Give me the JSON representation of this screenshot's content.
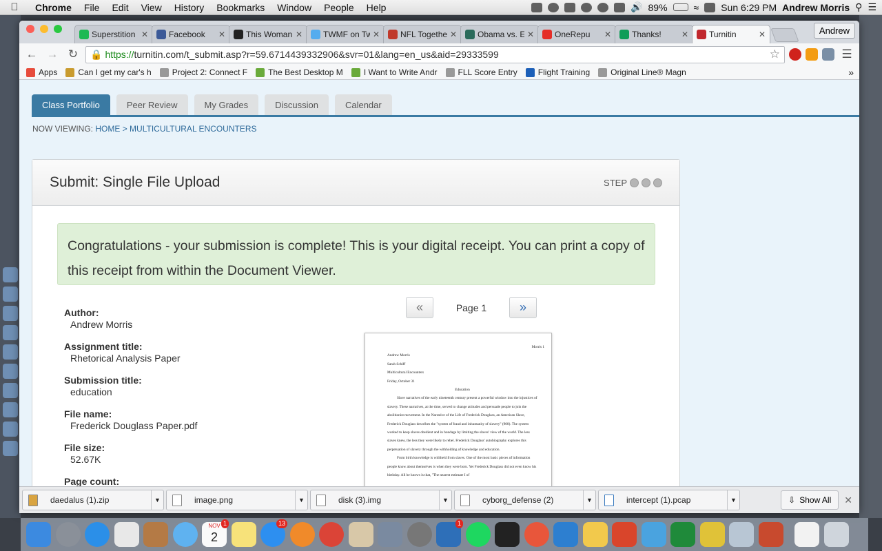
{
  "menubar": {
    "app": "Chrome",
    "items": [
      "File",
      "Edit",
      "View",
      "History",
      "Bookmarks",
      "Window",
      "People",
      "Help"
    ],
    "battery": "89%",
    "clock": "Sun 6:29 PM",
    "user": "Andrew Morris"
  },
  "browser": {
    "profile": "Andrew",
    "tabs": [
      {
        "title": "Superstition",
        "color": "#1db954"
      },
      {
        "title": "Facebook",
        "color": "#3b5998"
      },
      {
        "title": "This Woman",
        "color": "#222222"
      },
      {
        "title": "TWMF on Tw",
        "color": "#55acee"
      },
      {
        "title": "NFL Togethe",
        "color": "#c0392b"
      },
      {
        "title": "Obama vs. E",
        "color": "#2b6b5b"
      },
      {
        "title": "OneRepu",
        "color": "#e52d27"
      },
      {
        "title": "Thanks!",
        "color": "#0f9d58"
      },
      {
        "title": "Turnitin",
        "color": "#c1272d",
        "active": true
      }
    ],
    "url_scheme": "https://",
    "url_rest": "turnitin.com/t_submit.asp?r=59.6714439332906&svr=01&lang=en_us&aid=29333599",
    "bookmarks": [
      {
        "label": "Apps",
        "color": "#e74c3c"
      },
      {
        "label": "Can I get my car's h",
        "color": "#c99b2e"
      },
      {
        "label": "Project 2: Connect F",
        "color": "#999999"
      },
      {
        "label": "The Best Desktop M",
        "color": "#6aaa3a"
      },
      {
        "label": "I Want to Write Andr",
        "color": "#6aaa3a"
      },
      {
        "label": "FLL Score Entry",
        "color": "#999999"
      },
      {
        "label": "Flight Training",
        "color": "#1c5fb8"
      },
      {
        "label": "Original Line® Magn",
        "color": "#999999"
      }
    ]
  },
  "page": {
    "tabs": [
      "Class Portfolio",
      "Peer Review",
      "My Grades",
      "Discussion",
      "Calendar"
    ],
    "breadcrumb_prefix": "NOW VIEWING:",
    "breadcrumb_home": "HOME",
    "breadcrumb_sep": ">",
    "breadcrumb_current": "MULTICULTURAL ENCOUNTERS",
    "panel_title": "Submit: Single File Upload",
    "step_label": "STEP",
    "alert": "Congratulations - your submission is complete! This is your digital receipt. You can print a copy of this receipt from within the Document Viewer.",
    "fields": [
      {
        "label": "Author:",
        "value": "Andrew Morris"
      },
      {
        "label": "Assignment title:",
        "value": "Rhetorical Analysis Paper"
      },
      {
        "label": "Submission title:",
        "value": "education"
      },
      {
        "label": "File name:",
        "value": "Frederick Douglass Paper.pdf"
      },
      {
        "label": "File size:",
        "value": "52.67K"
      },
      {
        "label": "Page count:",
        "value": ""
      }
    ],
    "pager_prev": "«",
    "pager_label": "Page 1",
    "pager_next": "»",
    "doc": {
      "header": "Morris 1",
      "lines": [
        "Andrew Morris",
        "Sarah Schiff",
        "Multicultural Encounters",
        "Friday, October 31"
      ],
      "title": "Education",
      "para1": "Slave narratives of the early nineteenth century present a powerful window into the injustices of slavery. These narratives, at the time, served to change attitudes and persuade people to join the abolitionist movement. In the Narrative of the Life of Frederick Douglass, an American Slave, Frederick Douglass describes the \"system of fraud and inhumanity of slavery\" (908). The system worked to keep slaves obedient and in bondage by limiting the slaves' view of the world. The less slaves knew, the less they were likely to rebel. Frederick Douglass' autobiography explores this perpetuation of slavery through the withholding of knowledge and education.",
      "para2": "From birth knowledge is withheld from slaves. One of the most basic pieces of information people know about themselves is when they were born. Yet Frederick Douglass did not even know his birthday. All he knows is that, \"The nearest estimate I of"
    }
  },
  "downloads": {
    "items": [
      "daedalus (1).zip",
      "image.png",
      "disk (3).img",
      "cyborg_defense (2)",
      "intercept (1).pcap"
    ],
    "show_all": "Show All"
  },
  "dock": {
    "badges": {
      "calendar_month": "NOV",
      "calendar_day": "2",
      "calendar_badge": "1",
      "appstore_badge": "13",
      "app_badge": "1"
    }
  }
}
